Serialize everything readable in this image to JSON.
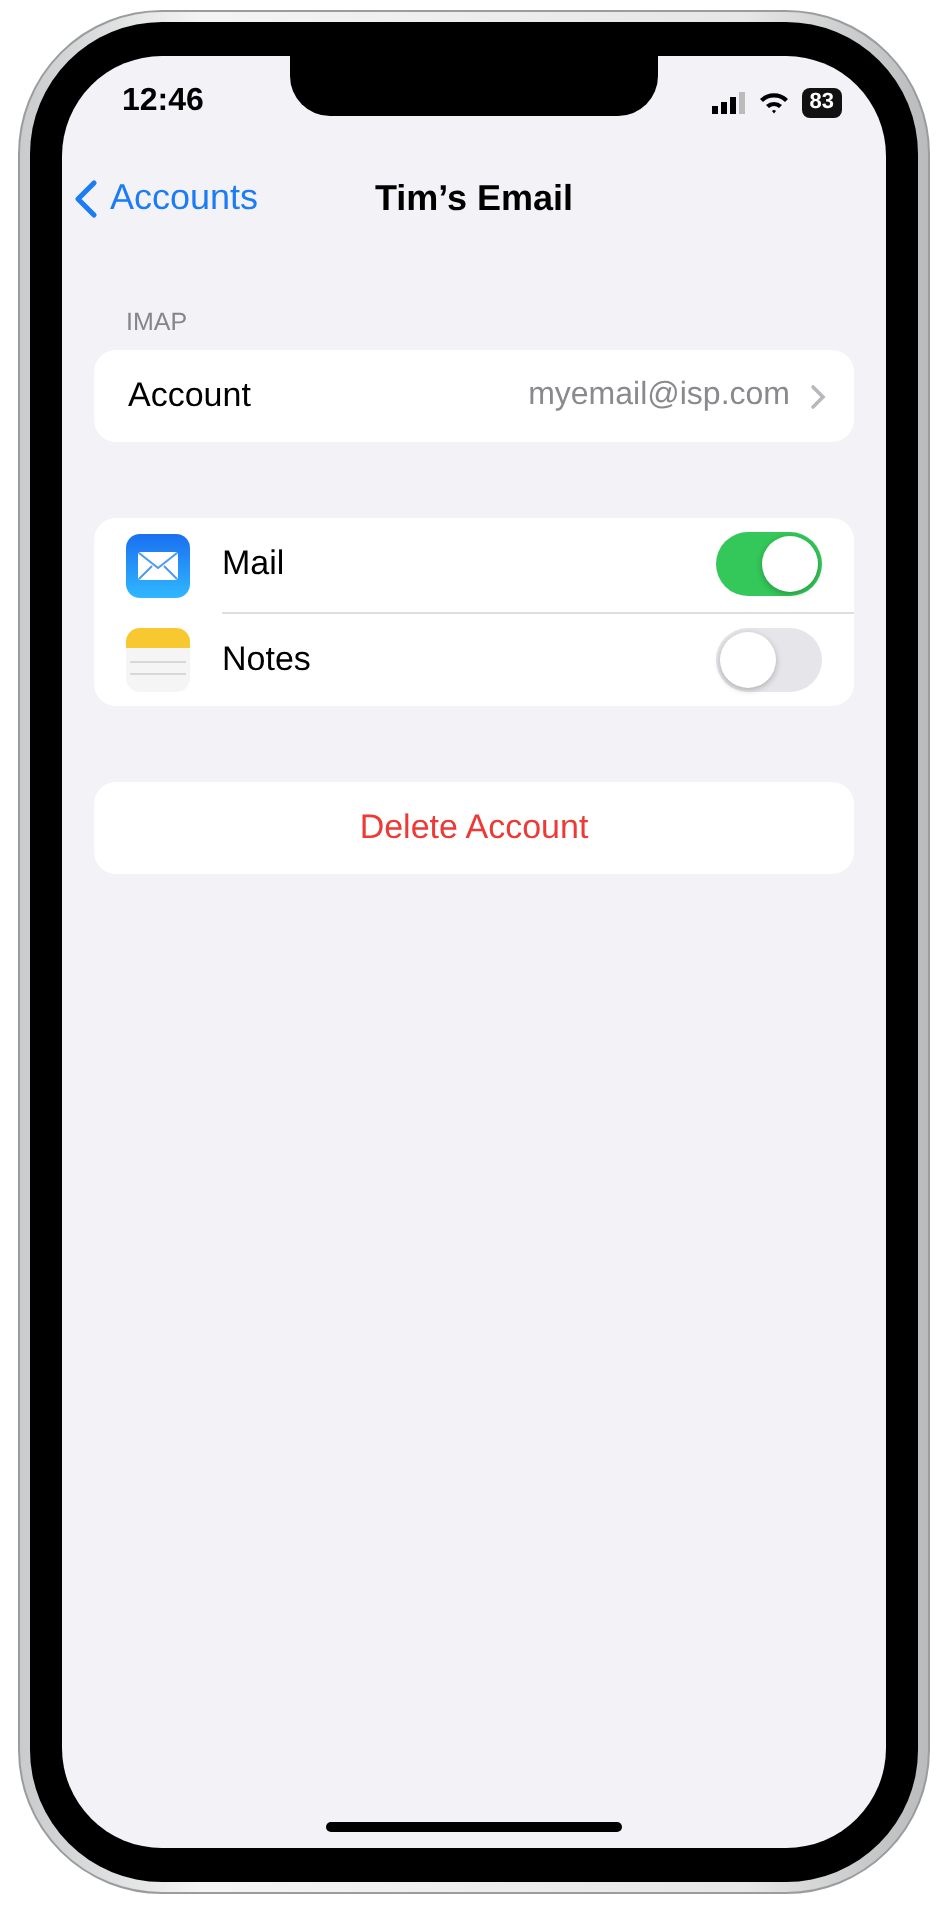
{
  "status_bar": {
    "time": "12:46",
    "battery": "83"
  },
  "nav": {
    "back": "Accounts",
    "title": "Tim’s Email"
  },
  "section_header": "IMAP",
  "account_row": {
    "label": "Account",
    "value": "myemail@isp.com"
  },
  "apps": [
    {
      "kind": "mail",
      "label": "Mail",
      "on": true
    },
    {
      "kind": "notes",
      "label": "Notes",
      "on": false
    }
  ],
  "delete_button": "Delete Account"
}
